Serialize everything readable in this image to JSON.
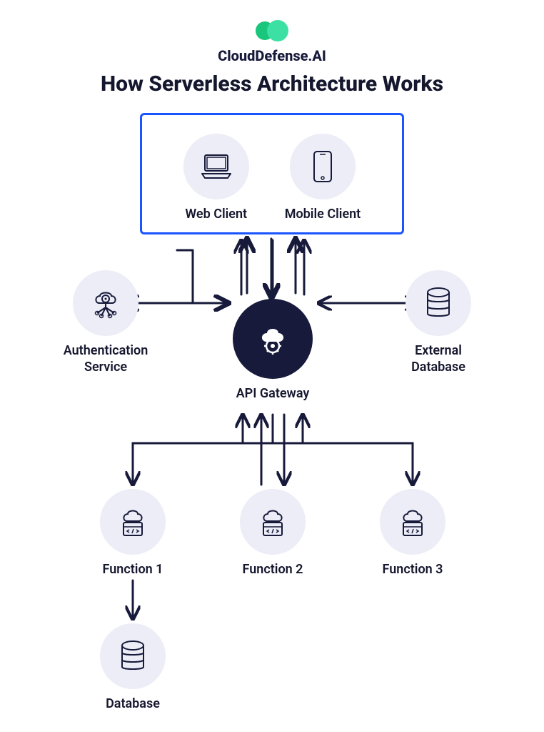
{
  "brand": {
    "name": "CloudDefense.AI"
  },
  "title": "How Serverless Architecture Works",
  "clients": [
    {
      "label": "Web Client",
      "icon": "laptop-icon"
    },
    {
      "label": "Mobile Client",
      "icon": "phone-icon"
    }
  ],
  "nodes": {
    "auth": {
      "label": "Authentication\nService",
      "icon": "auth-service-icon"
    },
    "extdb": {
      "label": "External\nDatabase",
      "icon": "database-icon"
    },
    "api": {
      "label": "API Gateway",
      "icon": "cloud-gear-icon"
    },
    "fn1": {
      "label": "Function 1",
      "icon": "cloud-code-icon"
    },
    "fn2": {
      "label": "Function 2",
      "icon": "cloud-code-icon"
    },
    "fn3": {
      "label": "Function 3",
      "icon": "cloud-code-icon"
    },
    "db": {
      "label": "Database",
      "icon": "database-icon"
    }
  },
  "colors": {
    "box_border": "#1a54ff",
    "node_bg": "#ecedf6",
    "api_bg": "#171a3a",
    "arrow": "#171a3a",
    "logo_green1": "#19c67b",
    "logo_green2": "#3de0a3"
  },
  "connections": [
    {
      "from": "clients",
      "to": "api",
      "bidirectional": true
    },
    {
      "from": "api",
      "to": "auth",
      "bidirectional": true
    },
    {
      "from": "api",
      "to": "extdb",
      "bidirectional": true
    },
    {
      "from": "api",
      "to": "fn1",
      "bidirectional": true
    },
    {
      "from": "api",
      "to": "fn2",
      "bidirectional": true
    },
    {
      "from": "api",
      "to": "fn3",
      "bidirectional": true
    },
    {
      "from": "fn1",
      "to": "db",
      "bidirectional": false
    }
  ]
}
